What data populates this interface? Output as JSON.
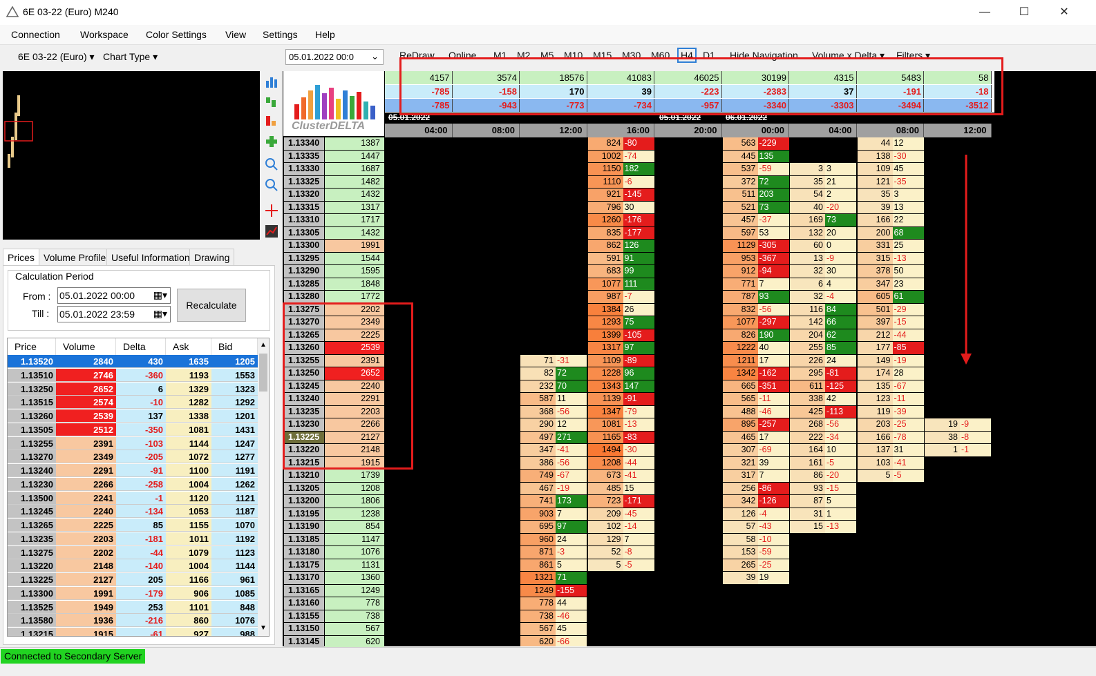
{
  "window": {
    "title": "6E 03-22 (Euro) M240",
    "minimize": "—",
    "maximize": "☐",
    "close": "✕"
  },
  "menu": [
    "Connection",
    "Workspace",
    "Color Settings",
    "View",
    "Settings",
    "Help"
  ],
  "toolbar": {
    "symbol": "6E 03-22 (Euro)",
    "chart_type": "Chart Type",
    "date": "05.01.2022 00:0",
    "buttons": [
      "ReDraw",
      "Online",
      "M1",
      "M2",
      "M5",
      "M10",
      "M15",
      "M30",
      "M60",
      "H4",
      "D1",
      "Hide Navigation",
      "Volume x Delta",
      "Filters"
    ],
    "active_timeframe": "H4"
  },
  "left_tabs": [
    "Prices",
    "Volume Profile",
    "Useful Information",
    "Drawing"
  ],
  "calc": {
    "group": "Calculation Period",
    "from_label": "From :",
    "from_value": "05.01.2022 00:00",
    "till_label": "Till :",
    "till_value": "05.01.2022 23:59",
    "recalc": "Recalculate"
  },
  "price_table": {
    "headers": [
      "Price",
      "Volume",
      "Delta",
      "Ask",
      "Bid"
    ],
    "rows": [
      [
        "1.13520",
        "2840",
        "430",
        "1635",
        "1205"
      ],
      [
        "1.13510",
        "2746",
        "-360",
        "1193",
        "1553"
      ],
      [
        "1.13250",
        "2652",
        "6",
        "1329",
        "1323"
      ],
      [
        "1.13515",
        "2574",
        "-10",
        "1282",
        "1292"
      ],
      [
        "1.13260",
        "2539",
        "137",
        "1338",
        "1201"
      ],
      [
        "1.13505",
        "2512",
        "-350",
        "1081",
        "1431"
      ],
      [
        "1.13255",
        "2391",
        "-103",
        "1144",
        "1247"
      ],
      [
        "1.13270",
        "2349",
        "-205",
        "1072",
        "1277"
      ],
      [
        "1.13240",
        "2291",
        "-91",
        "1100",
        "1191"
      ],
      [
        "1.13230",
        "2266",
        "-258",
        "1004",
        "1262"
      ],
      [
        "1.13500",
        "2241",
        "-1",
        "1120",
        "1121"
      ],
      [
        "1.13245",
        "2240",
        "-134",
        "1053",
        "1187"
      ],
      [
        "1.13265",
        "2225",
        "85",
        "1155",
        "1070"
      ],
      [
        "1.13235",
        "2203",
        "-181",
        "1011",
        "1192"
      ],
      [
        "1.13275",
        "2202",
        "-44",
        "1079",
        "1123"
      ],
      [
        "1.13220",
        "2148",
        "-140",
        "1004",
        "1144"
      ],
      [
        "1.13225",
        "2127",
        "205",
        "1166",
        "961"
      ],
      [
        "1.13300",
        "1991",
        "-179",
        "906",
        "1085"
      ],
      [
        "1.13525",
        "1949",
        "253",
        "1101",
        "848"
      ],
      [
        "1.13580",
        "1936",
        "-216",
        "860",
        "1076"
      ],
      [
        "1.13215",
        "1915",
        "-61",
        "927",
        "988"
      ]
    ]
  },
  "ladder": [
    [
      "1.13340",
      "1387"
    ],
    [
      "1.13335",
      "1447"
    ],
    [
      "1.13330",
      "1687"
    ],
    [
      "1.13325",
      "1482"
    ],
    [
      "1.13320",
      "1432"
    ],
    [
      "1.13315",
      "1317"
    ],
    [
      "1.13310",
      "1717"
    ],
    [
      "1.13305",
      "1432"
    ],
    [
      "1.13300",
      "1991"
    ],
    [
      "1.13295",
      "1544"
    ],
    [
      "1.13290",
      "1595"
    ],
    [
      "1.13285",
      "1848"
    ],
    [
      "1.13280",
      "1772"
    ],
    [
      "1.13275",
      "2202"
    ],
    [
      "1.13270",
      "2349"
    ],
    [
      "1.13265",
      "2225"
    ],
    [
      "1.13260",
      "2539"
    ],
    [
      "1.13255",
      "2391"
    ],
    [
      "1.13250",
      "2652"
    ],
    [
      "1.13245",
      "2240"
    ],
    [
      "1.13240",
      "2291"
    ],
    [
      "1.13235",
      "2203"
    ],
    [
      "1.13230",
      "2266"
    ],
    [
      "1.13225",
      "2127"
    ],
    [
      "1.13220",
      "2148"
    ],
    [
      "1.13215",
      "1915"
    ],
    [
      "1.13210",
      "1739"
    ],
    [
      "1.13205",
      "1208"
    ],
    [
      "1.13200",
      "1806"
    ],
    [
      "1.13195",
      "1238"
    ],
    [
      "1.13190",
      "854"
    ],
    [
      "1.13185",
      "1147"
    ],
    [
      "1.13180",
      "1076"
    ],
    [
      "1.13175",
      "1131"
    ],
    [
      "1.13170",
      "1360"
    ],
    [
      "1.13165",
      "1249"
    ],
    [
      "1.13160",
      "778"
    ],
    [
      "1.13155",
      "738"
    ],
    [
      "1.13150",
      "567"
    ],
    [
      "1.13145",
      "620"
    ]
  ],
  "summary": {
    "volume": [
      "4157",
      "3574",
      "18576",
      "41083",
      "46025",
      "30199",
      "4315",
      "5483",
      "58"
    ],
    "delta": [
      "-785",
      "-158",
      "170",
      "39",
      "-223",
      "-2383",
      "37",
      "-191",
      "-18"
    ],
    "cum_delta": [
      "-785",
      "-943",
      "-773",
      "-734",
      "-957",
      "-3340",
      "-3303",
      "-3494",
      "-3512"
    ]
  },
  "dates": [
    "05.01.2022",
    "05.01.2022",
    "06.01.2022"
  ],
  "times": [
    "04:00",
    "08:00",
    "12:00",
    "16:00",
    "20:00",
    "00:00",
    "04:00",
    "08:00",
    "12:00"
  ],
  "footprint": [
    {
      "col": 2,
      "start": 17,
      "cells": [
        [
          "71",
          "-31"
        ],
        [
          "82",
          "72"
        ],
        [
          "232",
          "70"
        ],
        [
          "587",
          "11"
        ],
        [
          "368",
          "-56"
        ],
        [
          "290",
          "12"
        ],
        [
          "497",
          "271"
        ],
        [
          "347",
          "-41"
        ],
        [
          "386",
          "-56"
        ],
        [
          "749",
          "-67"
        ],
        [
          "467",
          "-19"
        ],
        [
          "741",
          "173"
        ],
        [
          "903",
          "7"
        ],
        [
          "695",
          "97"
        ],
        [
          "960",
          "24"
        ],
        [
          "871",
          "-3"
        ],
        [
          "861",
          "5"
        ],
        [
          "1321",
          "71"
        ],
        [
          "1249",
          "-155"
        ],
        [
          "778",
          "44"
        ],
        [
          "738",
          "-46"
        ],
        [
          "567",
          "45"
        ],
        [
          "620",
          "-66"
        ]
      ]
    },
    {
      "col": 3,
      "start": 0,
      "cells": [
        [
          "824",
          "-80"
        ],
        [
          "1002",
          "-74"
        ],
        [
          "1150",
          "182"
        ],
        [
          "1110",
          "-6"
        ],
        [
          "921",
          "-145"
        ],
        [
          "796",
          "30"
        ],
        [
          "1260",
          "-176"
        ],
        [
          "835",
          "-177"
        ],
        [
          "862",
          "126"
        ],
        [
          "591",
          "91"
        ],
        [
          "683",
          "99"
        ],
        [
          "1077",
          "111"
        ],
        [
          "987",
          "-7"
        ],
        [
          "1384",
          "26"
        ],
        [
          "1293",
          "75"
        ],
        [
          "1399",
          "-105"
        ],
        [
          "1317",
          "97"
        ],
        [
          "1109",
          "-89"
        ],
        [
          "1228",
          "96"
        ],
        [
          "1343",
          "147"
        ],
        [
          "1139",
          "-91"
        ],
        [
          "1347",
          "-79"
        ],
        [
          "1081",
          "-13"
        ],
        [
          "1165",
          "-83"
        ],
        [
          "1494",
          "-30"
        ],
        [
          "1208",
          "-44"
        ],
        [
          "673",
          "-41"
        ],
        [
          "485",
          "15"
        ],
        [
          "723",
          "-171"
        ],
        [
          "209",
          "-45"
        ],
        [
          "102",
          "-14"
        ],
        [
          "129",
          "7"
        ],
        [
          "52",
          "-8"
        ],
        [
          "5",
          "-5"
        ]
      ]
    },
    {
      "col": 5,
      "start": 0,
      "cells": [
        [
          "563",
          "-229"
        ],
        [
          "445",
          "135"
        ],
        [
          "537",
          "-59"
        ],
        [
          "372",
          "72"
        ],
        [
          "511",
          "203"
        ],
        [
          "521",
          "73"
        ],
        [
          "457",
          "-37"
        ],
        [
          "597",
          "53"
        ],
        [
          "1129",
          "-305"
        ],
        [
          "953",
          "-367"
        ],
        [
          "912",
          "-94"
        ],
        [
          "771",
          "7"
        ],
        [
          "787",
          "93"
        ],
        [
          "832",
          "-56"
        ],
        [
          "1077",
          "-297"
        ],
        [
          "826",
          "190"
        ],
        [
          "1222",
          "40"
        ],
        [
          "1211",
          "17"
        ],
        [
          "1342",
          "-162"
        ],
        [
          "665",
          "-351"
        ],
        [
          "565",
          "-11"
        ],
        [
          "488",
          "-46"
        ],
        [
          "895",
          "-257"
        ],
        [
          "465",
          "17"
        ],
        [
          "307",
          "-69"
        ],
        [
          "321",
          "39"
        ],
        [
          "317",
          "7"
        ],
        [
          "256",
          "-86"
        ],
        [
          "342",
          "-126"
        ],
        [
          "126",
          "-4"
        ],
        [
          "57",
          "-43"
        ],
        [
          "58",
          "-10"
        ],
        [
          "153",
          "-59"
        ],
        [
          "265",
          "-25"
        ],
        [
          "39",
          "19"
        ]
      ]
    },
    {
      "col": 6,
      "start": 2,
      "cells": [
        [
          "3",
          "3"
        ],
        [
          "35",
          "21"
        ],
        [
          "54",
          "2"
        ],
        [
          "40",
          "-20"
        ],
        [
          "169",
          "73"
        ],
        [
          "132",
          "20"
        ],
        [
          "60",
          "0"
        ],
        [
          "13",
          "-9"
        ],
        [
          "32",
          "30"
        ],
        [
          "6",
          "4"
        ],
        [
          "32",
          "-4"
        ],
        [
          "116",
          "84"
        ],
        [
          "142",
          "66"
        ],
        [
          "204",
          "62"
        ],
        [
          "255",
          "85"
        ],
        [
          "226",
          "24"
        ],
        [
          "295",
          "-81"
        ],
        [
          "611",
          "-125"
        ],
        [
          "338",
          "42"
        ],
        [
          "425",
          "-113"
        ],
        [
          "268",
          "-56"
        ],
        [
          "222",
          "-34"
        ],
        [
          "164",
          "10"
        ],
        [
          "161",
          "-5"
        ],
        [
          "86",
          "-20"
        ],
        [
          "93",
          "-15"
        ],
        [
          "87",
          "5"
        ],
        [
          "31",
          "1"
        ],
        [
          "15",
          "-13"
        ]
      ]
    },
    {
      "col": 7,
      "start": 0,
      "cells": [
        [
          "44",
          "12"
        ],
        [
          "138",
          "-30"
        ],
        [
          "109",
          "45"
        ],
        [
          "121",
          "-35"
        ],
        [
          "35",
          "3"
        ],
        [
          "39",
          "13"
        ],
        [
          "166",
          "22"
        ],
        [
          "200",
          "68"
        ],
        [
          "331",
          "25"
        ],
        [
          "315",
          "-13"
        ],
        [
          "378",
          "50"
        ],
        [
          "347",
          "23"
        ],
        [
          "605",
          "61"
        ],
        [
          "501",
          "-29"
        ],
        [
          "397",
          "-15"
        ],
        [
          "212",
          "-44"
        ],
        [
          "177",
          "-85"
        ],
        [
          "149",
          "-19"
        ],
        [
          "174",
          "28"
        ],
        [
          "135",
          "-67"
        ],
        [
          "123",
          "-11"
        ],
        [
          "119",
          "-39"
        ],
        [
          "203",
          "-25"
        ],
        [
          "166",
          "-78"
        ],
        [
          "137",
          "31"
        ],
        [
          "103",
          "-41"
        ],
        [
          "5",
          "-5"
        ]
      ]
    },
    {
      "col": 8,
      "start": 22,
      "cells": [
        [
          "19",
          "-9"
        ],
        [
          "38",
          "-8"
        ],
        [
          "1",
          "-1"
        ]
      ]
    }
  ],
  "status": "Connected to Secondary Server",
  "colors": {
    "accent_red": "#e41c1c",
    "highlight_blue": "#1a73d9",
    "status_green": "#21d321"
  }
}
